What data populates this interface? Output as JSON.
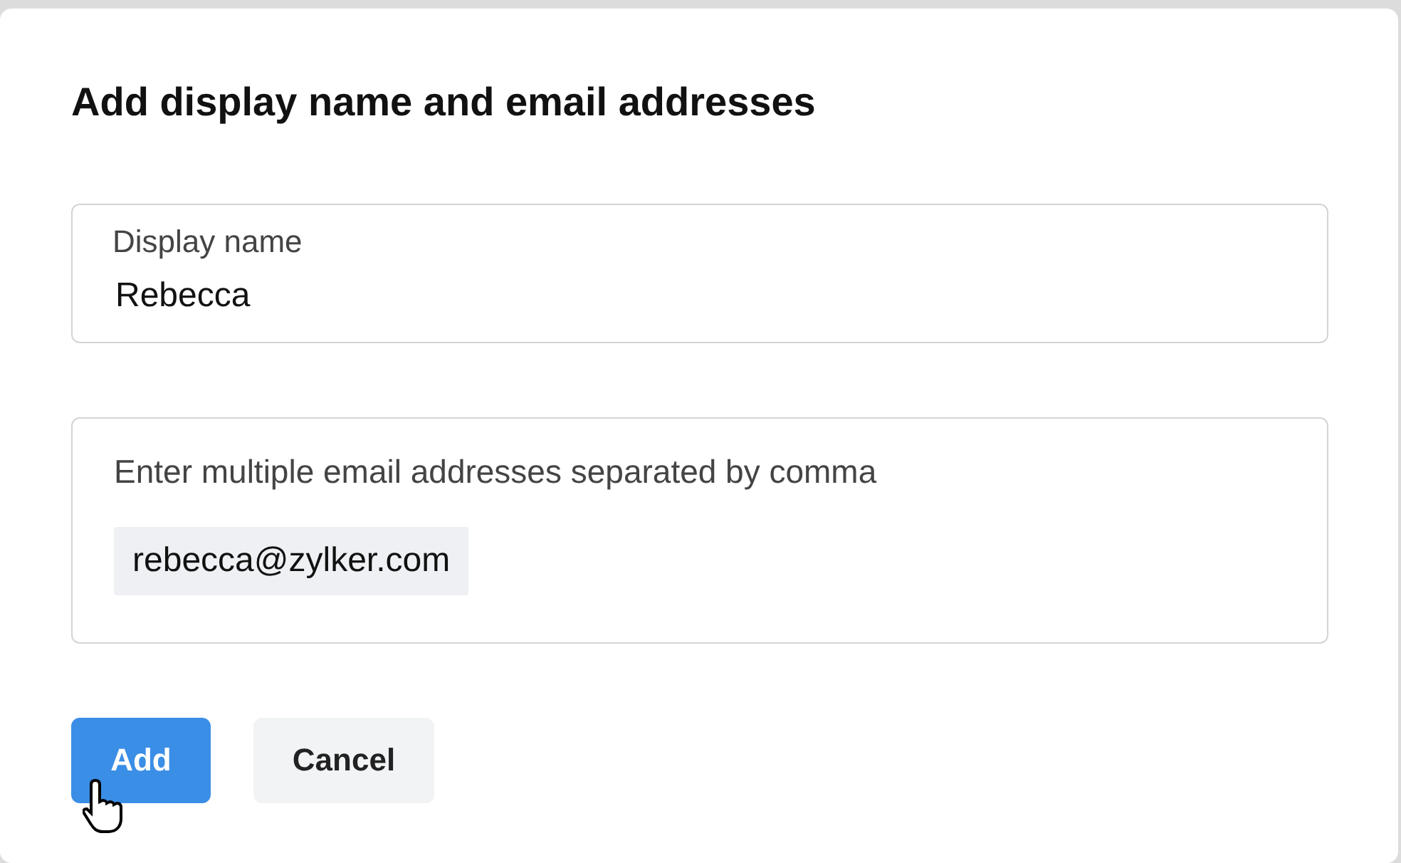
{
  "dialog": {
    "title": "Add display name and email addresses",
    "display_name": {
      "label": "Display name",
      "value": "Rebecca"
    },
    "emails": {
      "placeholder": "Enter multiple email addresses separated by comma",
      "chips": [
        "rebecca@zylker.com"
      ]
    },
    "buttons": [
      {
        "label": "Add",
        "kind": "primary"
      },
      {
        "label": "Cancel",
        "kind": "secondary"
      }
    ]
  }
}
